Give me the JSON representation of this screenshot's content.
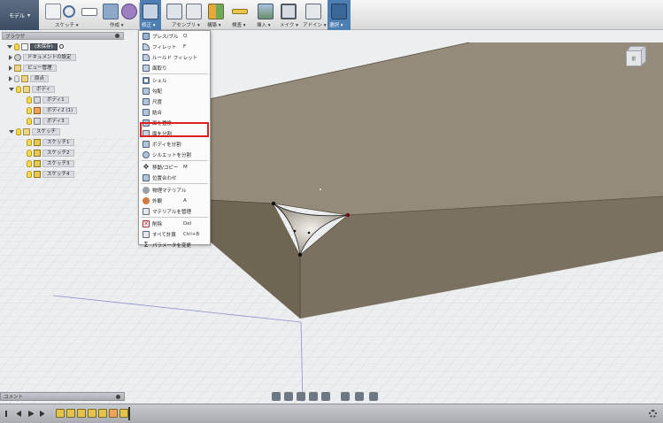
{
  "toolbar": {
    "workspace": "モデル",
    "groups": [
      {
        "label": "スケッチ ▾"
      },
      {
        "label": "作成 ▾"
      },
      {
        "label": "修正 ▾"
      },
      {
        "label": "アセンブリ ▾"
      },
      {
        "label": "構築 ▾"
      },
      {
        "label": "検査 ▾"
      },
      {
        "label": "挿入 ▾"
      },
      {
        "label": "メイク ▾"
      },
      {
        "label": "アドイン ▾"
      },
      {
        "label": "選択 ▾"
      }
    ]
  },
  "browser": {
    "title": "ブラウザ",
    "root_name": "(未保存)",
    "items": [
      {
        "label": "ドキュメントの設定"
      },
      {
        "label": "ビュー管理"
      },
      {
        "label": "原点"
      },
      {
        "label": "ボディ"
      },
      {
        "label": "ボディ1"
      },
      {
        "label": "ボディ2 (1)"
      },
      {
        "label": "ボディ3"
      },
      {
        "label": "スケッチ"
      },
      {
        "label": "スケッチ1"
      },
      {
        "label": "スケッチ2"
      },
      {
        "label": "スケッチ3"
      },
      {
        "label": "スケッチ4"
      }
    ]
  },
  "menu": {
    "items": [
      {
        "label": "プレス/プル",
        "shortcut": "Q"
      },
      {
        "label": "フィレット",
        "shortcut": "F"
      },
      {
        "label": "ルールド フィレット",
        "shortcut": ""
      },
      {
        "label": "面取り",
        "shortcut": ""
      },
      {
        "label": "シェル",
        "shortcut": ""
      },
      {
        "label": "勾配",
        "shortcut": ""
      },
      {
        "label": "尺度",
        "shortcut": ""
      },
      {
        "label": "結合",
        "shortcut": ""
      },
      {
        "label": "面を置換",
        "shortcut": ""
      },
      {
        "label": "面を分割",
        "shortcut": ""
      },
      {
        "label": "ボディを分割",
        "shortcut": ""
      },
      {
        "label": "シルエットを分割",
        "shortcut": ""
      },
      {
        "label": "移動/コピー",
        "shortcut": "M"
      },
      {
        "label": "位置合わせ",
        "shortcut": ""
      },
      {
        "label": "物理マテリアル",
        "shortcut": ""
      },
      {
        "label": "外観",
        "shortcut": "A"
      },
      {
        "label": "マテリアルを管理",
        "shortcut": ""
      },
      {
        "label": "削除",
        "shortcut": "Del"
      },
      {
        "label": "すべて計算",
        "shortcut": "Ctrl+B"
      },
      {
        "label": "パラメータを変更",
        "shortcut": ""
      }
    ]
  },
  "viewcube": {
    "face": "前"
  },
  "comment": {
    "label": "コメント"
  },
  "colors": {
    "accent": "#4e7fb3",
    "highlight": "#e01f1f",
    "model_top": "#948b7b",
    "model_side": "#6e6554"
  }
}
